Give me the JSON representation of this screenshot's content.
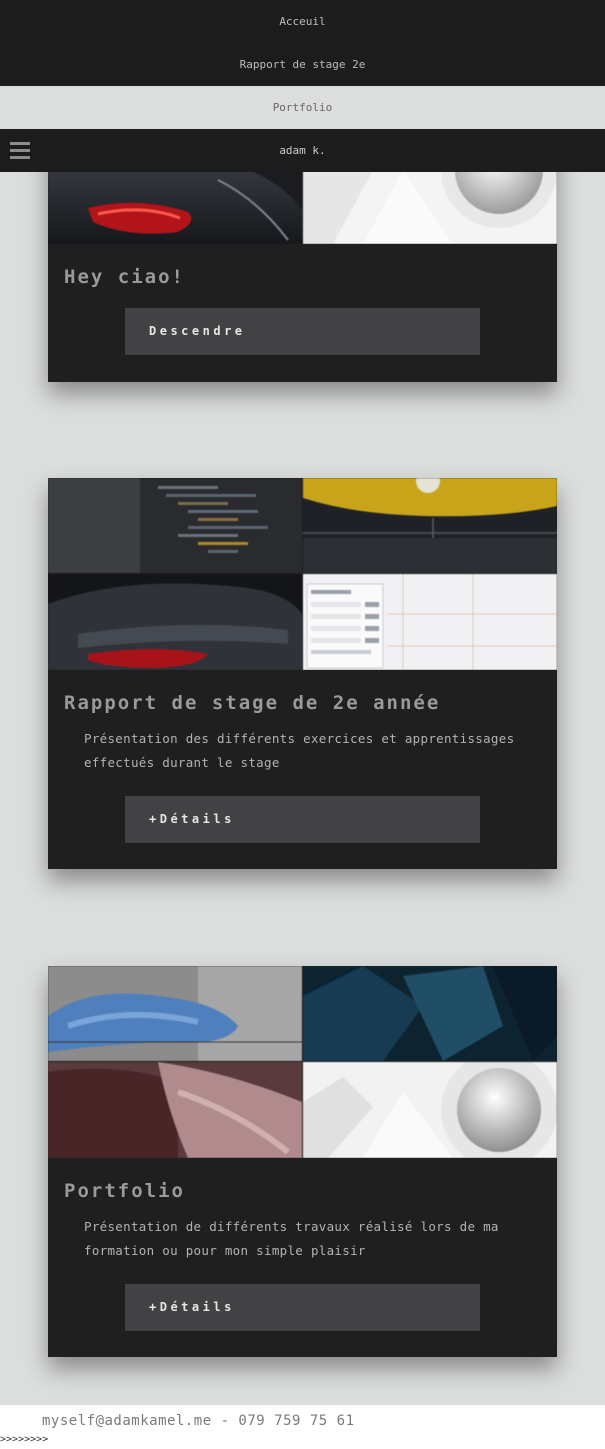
{
  "nav": {
    "items": [
      {
        "label": "Acceuil"
      },
      {
        "label": "Rapport de stage 2e"
      },
      {
        "label": "Portfolio"
      }
    ],
    "brand": "adam k."
  },
  "hero": {
    "title": "Hey ciao!",
    "button": "Descendre"
  },
  "cards": [
    {
      "title": "Rapport de stage de 2e année",
      "description": "Présentation des différents exercices et apprentissages effectués durant le stage",
      "button": "+Détails"
    },
    {
      "title": "Portfolio",
      "description": "Présentation de différents travaux réalisé lors de ma formation ou pour mon simple plaisir",
      "button": "+Détails"
    }
  ],
  "footer": {
    "contact": "myself@adamkamel.me - 079 759 75 61",
    "arrows": ">>>>>>>>"
  }
}
